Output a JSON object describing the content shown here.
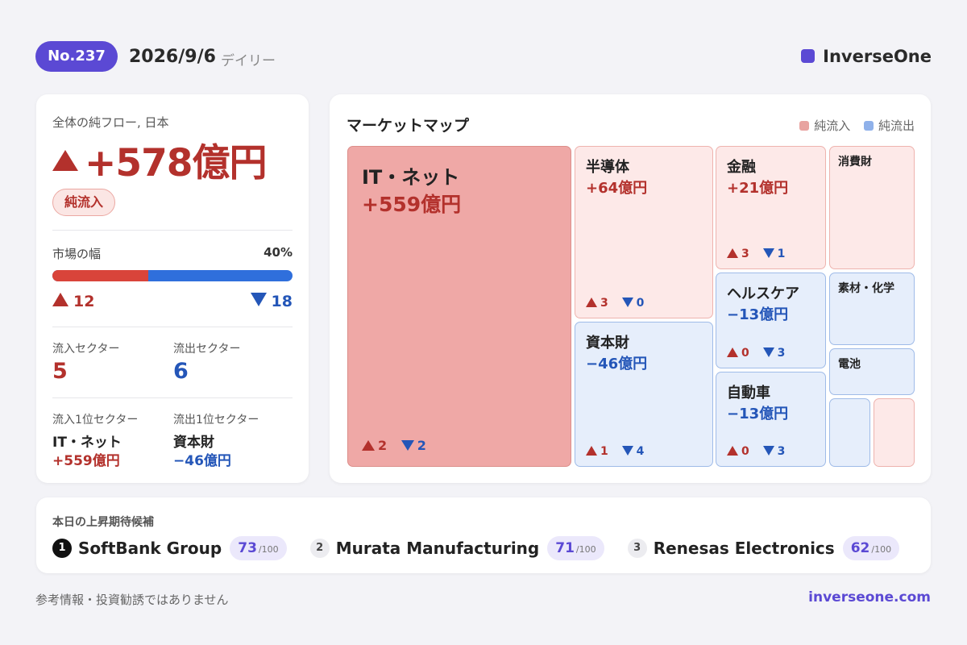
{
  "header": {
    "issue": "No.237",
    "date": "2026/9/6",
    "edition": "デイリー",
    "brand": "InverseOne",
    "brand_color": "#5b49d4"
  },
  "summary": {
    "net_flow_label": "全体の純フロー, 日本",
    "net_flow_value": "+578億円",
    "net_flow_badge": "純流入",
    "breadth_label": "市場の幅",
    "breadth_pct_text": "40%",
    "breadth_fraction": 0.4,
    "advancers": "12",
    "decliners": "18",
    "inflow_sectors_label": "流入セクター",
    "inflow_sectors_count": "5",
    "outflow_sectors_label": "流出セクター",
    "outflow_sectors_count": "6",
    "top_inflow_label": "流入1位セクター",
    "top_inflow_name": "IT・ネット",
    "top_inflow_value": "+559億円",
    "top_outflow_label": "流出1位セクター",
    "top_outflow_name": "資本財",
    "top_outflow_value": "−46億円"
  },
  "market_map": {
    "title": "マーケットマップ",
    "legend_inflow": "純流入",
    "legend_outflow": "純流出",
    "inflow_color": "#e8a3a0",
    "outflow_color": "#8fb1ea",
    "tiles": {
      "it": {
        "name": "IT・ネット",
        "value": "+559億円",
        "up": "2",
        "down": "2"
      },
      "semi": {
        "name": "半導体",
        "value": "+64億円",
        "up": "3",
        "down": "0"
      },
      "capital": {
        "name": "資本財",
        "value": "−46億円",
        "up": "1",
        "down": "4"
      },
      "finance": {
        "name": "金融",
        "value": "+21億円",
        "up": "3",
        "down": "1"
      },
      "health": {
        "name": "ヘルスケア",
        "value": "−13億円",
        "up": "0",
        "down": "3"
      },
      "auto": {
        "name": "自動車",
        "value": "−13億円",
        "up": "0",
        "down": "3"
      },
      "consumer": {
        "name": "消費財"
      },
      "materials": {
        "name": "素材・化学"
      },
      "battery": {
        "name": "電池"
      }
    }
  },
  "candidates": {
    "title": "本日の上昇期待候補",
    "items": [
      {
        "rank": "1",
        "name": "SoftBank Group",
        "score": "73",
        "max": "/100"
      },
      {
        "rank": "2",
        "name": "Murata Manufacturing",
        "score": "71",
        "max": "/100"
      },
      {
        "rank": "3",
        "name": "Renesas Electronics",
        "score": "62",
        "max": "/100"
      }
    ]
  },
  "footer": {
    "disclaimer": "参考情報・投資勧誘ではありません",
    "url": "inverseone.com"
  }
}
